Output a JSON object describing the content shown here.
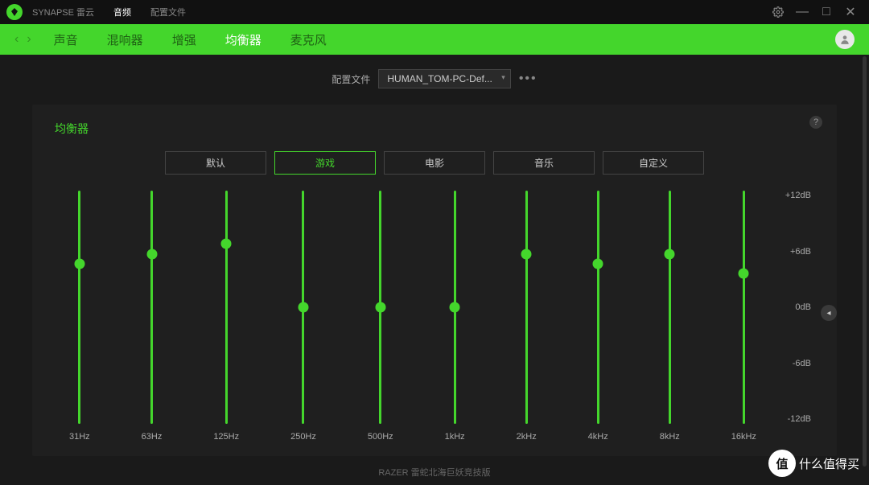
{
  "titlebar": {
    "app_name": "SYNAPSE 雷云",
    "tabs": [
      "音频",
      "配置文件"
    ],
    "active_tab": 0
  },
  "nav": {
    "items": [
      "声音",
      "混响器",
      "增强",
      "均衡器",
      "麦克风"
    ],
    "active": 3
  },
  "profile": {
    "label": "配置文件",
    "selected": "HUMAN_TOM-PC-Def..."
  },
  "panel": {
    "title": "均衡器"
  },
  "presets": {
    "items": [
      "默认",
      "游戏",
      "电影",
      "音乐",
      "自定义"
    ],
    "active": 1
  },
  "eq": {
    "bands": [
      {
        "freq": "31Hz",
        "value_db": 4.5
      },
      {
        "freq": "63Hz",
        "value_db": 5.5
      },
      {
        "freq": "125Hz",
        "value_db": 6.5
      },
      {
        "freq": "250Hz",
        "value_db": 0
      },
      {
        "freq": "500Hz",
        "value_db": 0
      },
      {
        "freq": "1kHz",
        "value_db": 0
      },
      {
        "freq": "2kHz",
        "value_db": 5.5
      },
      {
        "freq": "4kHz",
        "value_db": 4.5
      },
      {
        "freq": "8kHz",
        "value_db": 5.5
      },
      {
        "freq": "16kHz",
        "value_db": 3.5
      }
    ],
    "db_scale": [
      "+12dB",
      "+6dB",
      "0dB",
      "-6dB",
      "-12dB"
    ],
    "db_min": -12,
    "db_max": 12
  },
  "footer": "RAZER 雷蛇北海巨妖竞技版",
  "watermark": {
    "badge": "值",
    "text": "什么值得买"
  },
  "colors": {
    "accent": "#44d62c",
    "bg": "#1a1a1a",
    "panel": "#1f1f1f"
  }
}
